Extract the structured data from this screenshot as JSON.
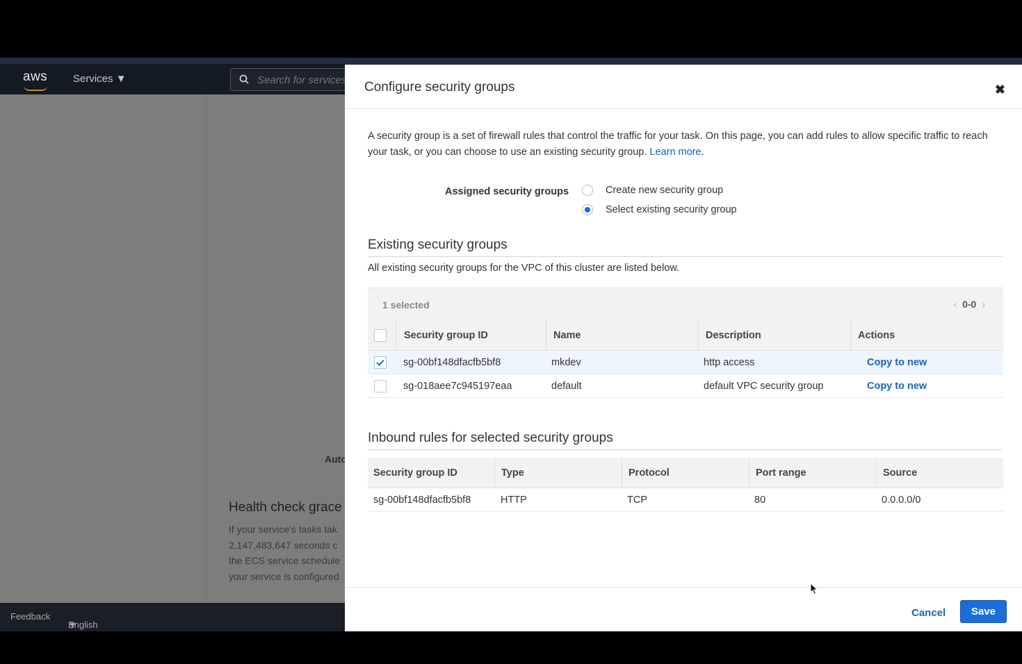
{
  "nav": {
    "logo_text": "aws",
    "services_label": "Services",
    "search_placeholder": "Search for services"
  },
  "background": {
    "auto_label": "Auto",
    "health_check_title": "Health check grace",
    "health_check_lines": [
      "If your service's tasks tak",
      "2,147,483,647 seconds c",
      "the ECS service schedule",
      "your service is configured"
    ]
  },
  "footer": {
    "feedback_label": "Feedback",
    "language_label": "English (US)"
  },
  "modal": {
    "title": "Configure security groups",
    "close_symbol": "✖",
    "intro_text": "A security group is a set of firewall rules that control the traffic for your task. On this page, you can add rules to allow specific traffic to reach your task, or you can choose to use an existing security group.",
    "learn_more_label": "Learn more",
    "assigned_label": "Assigned security groups",
    "radio_options": [
      {
        "label": "Create new security group",
        "selected": false
      },
      {
        "label": "Select existing security group",
        "selected": true
      }
    ],
    "existing": {
      "title": "Existing security groups",
      "subtitle": "All existing security groups for the VPC of this cluster are listed below.",
      "selected_count": "1 selected",
      "pager": "0-0",
      "columns": [
        "Security group ID",
        "Name",
        "Description",
        "Actions"
      ],
      "rows": [
        {
          "id": "sg-00bf148dfacfb5bf8",
          "name": "mkdev",
          "description": "http access",
          "action": "Copy to new",
          "checked": true
        },
        {
          "id": "sg-018aee7c945197eaa",
          "name": "default",
          "description": "default VPC security group",
          "action": "Copy to new",
          "checked": false
        }
      ]
    },
    "inbound": {
      "title": "Inbound rules for selected security groups",
      "columns": [
        "Security group ID",
        "Type",
        "Protocol",
        "Port range",
        "Source"
      ],
      "rows": [
        {
          "id": "sg-00bf148dfacfb5bf8",
          "type": "HTTP",
          "protocol": "TCP",
          "port_range": "80",
          "source": "0.0.0.0/0"
        }
      ]
    },
    "cancel_label": "Cancel",
    "save_label": "Save"
  },
  "colors": {
    "primary_blue": "#1b6ed8",
    "link_blue": "#1b65b8",
    "nav_bg": "#131a22"
  }
}
